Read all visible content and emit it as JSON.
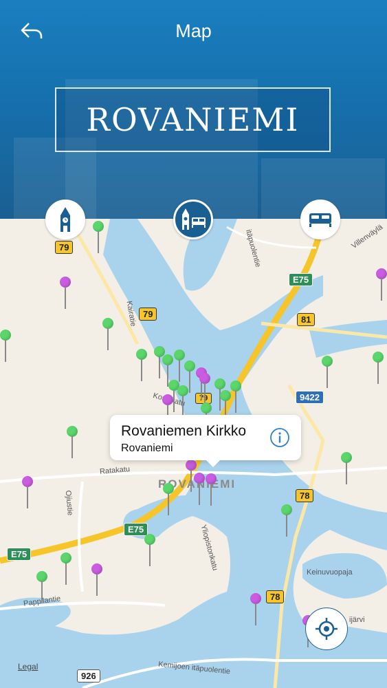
{
  "header": {
    "title": "Map",
    "city_name": "ROVANIEMI",
    "back_icon": "back-arrow-icon"
  },
  "category_buttons": [
    {
      "name": "sights",
      "icon": "clock-tower-icon",
      "active": false
    },
    {
      "name": "all",
      "icon": "tower-and-bed-icon",
      "active": true
    },
    {
      "name": "hotels",
      "icon": "bed-icon",
      "active": false
    }
  ],
  "map": {
    "city_label": "ROVANIEMI",
    "road_labels": [
      "Kairatie",
      "Ratakatu",
      "Ojiustie",
      "Yliopistonkatu",
      "Pappilantie",
      "Kemijoen itäpuolentie",
      "itäpuolentie",
      "Villenväylä",
      "Keinuvuopaja",
      "Koskikatu",
      "ijärvi"
    ],
    "road_shields": [
      "79",
      "79",
      "E75",
      "81",
      "9422",
      "78",
      "E75",
      "E75",
      "78",
      "926",
      "79"
    ],
    "legal": "Legal"
  },
  "callout": {
    "title": "Rovaniemen Kirkko",
    "subtitle": "Rovaniemi",
    "info_icon": "info-icon"
  },
  "colors": {
    "header_blue": "#1670ad",
    "pin_green": "#5bd66b",
    "pin_purple": "#c95ce0",
    "water": "#a9d3ec",
    "land": "#f3efe6"
  }
}
